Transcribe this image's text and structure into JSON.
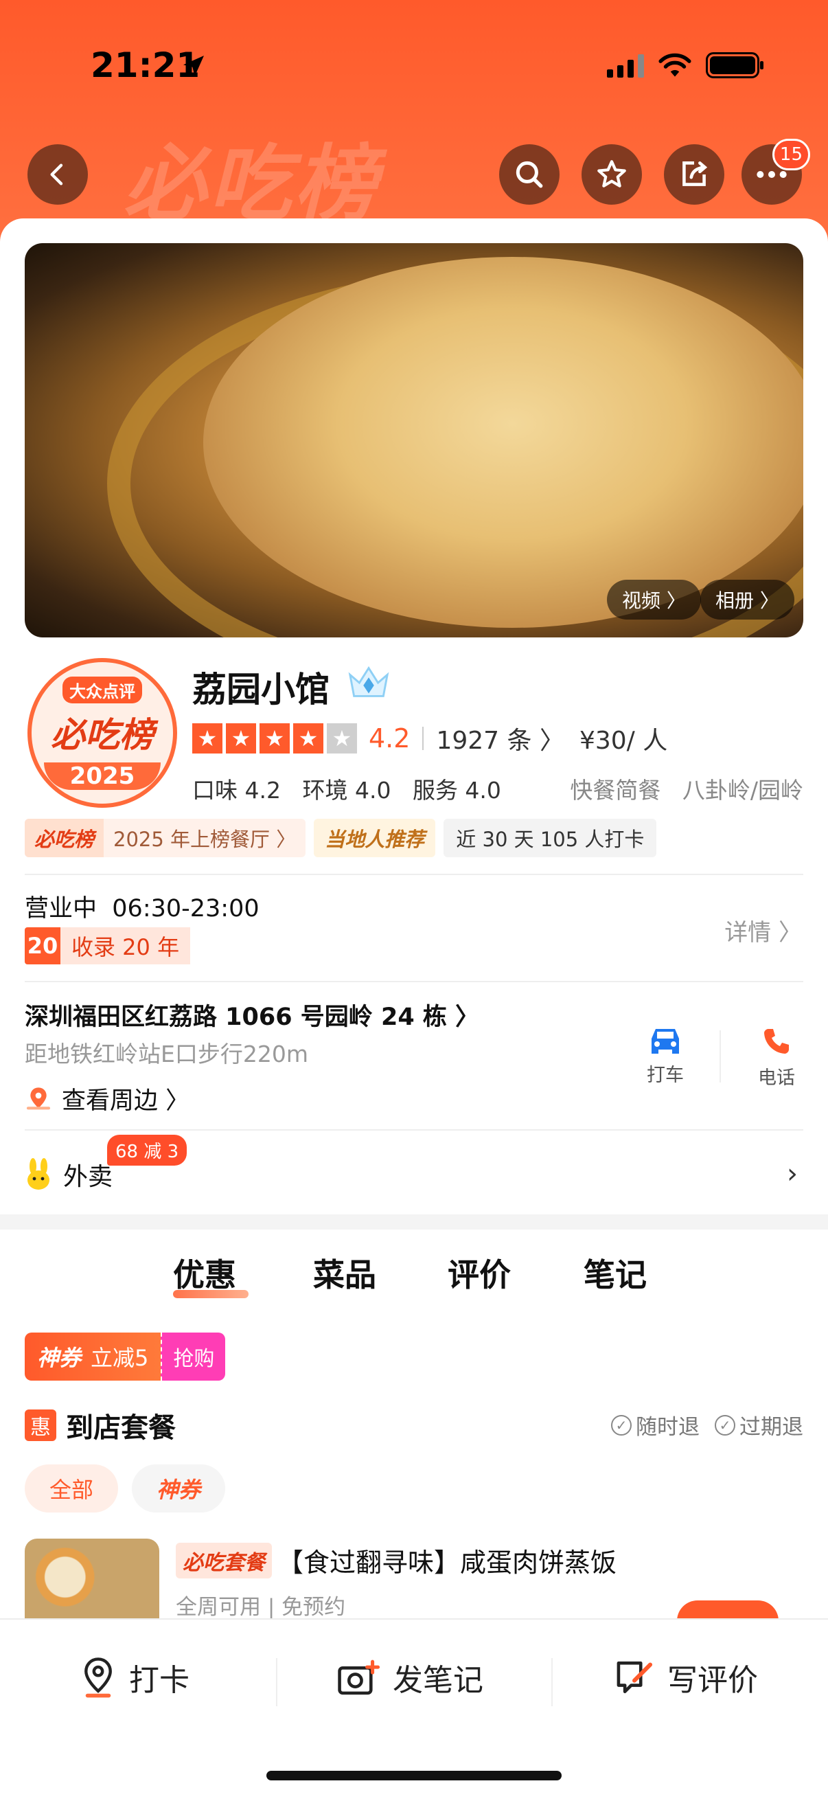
{
  "status": {
    "time": "21:21"
  },
  "nav": {
    "badge_count": "15"
  },
  "gallery": {
    "video_label": "视频 〉",
    "album_label": "相册 〉"
  },
  "medal": {
    "brand": "大众点评",
    "title": "必吃榜",
    "year": "2025"
  },
  "shop": {
    "name": "荔园小馆",
    "score": "4.2",
    "stars": 4,
    "review_count": "1927 条 〉",
    "price": "¥30/ 人",
    "taste": "口味 4.2",
    "environment": "环境 4.0",
    "service": "服务 4.0",
    "category": "快餐简餐",
    "area": "八卦岭/园岭"
  },
  "tags": {
    "list_logo": "必吃榜",
    "list_text": "2025 年上榜餐厅 〉",
    "local": "当地人推荐",
    "checkin": "近 30 天 105 人打卡"
  },
  "hours": {
    "status": "营业中",
    "time": "06:30-23:00",
    "detail": "详情 〉",
    "since_num": "20",
    "since_text": "收录 20 年"
  },
  "location": {
    "address": "深圳福田区红荔路 1066 号园岭 24 栋 〉",
    "metro": "距地铁红岭站E口步行220m",
    "nearby": "查看周边 〉",
    "taxi_label": "打车",
    "phone_label": "电话"
  },
  "takeout": {
    "label": "外卖",
    "badge": "68 减 3"
  },
  "tabs": [
    "优惠",
    "菜品",
    "评价",
    "笔记"
  ],
  "coupon": {
    "tag": "神券",
    "text": "立减5",
    "action": "抢购"
  },
  "package": {
    "icon_text": "惠",
    "title": "到店套餐",
    "policy_1": "随时退",
    "policy_2": "过期退",
    "filter_all": "全部",
    "filter_coupon": "神券"
  },
  "deal": {
    "tag": "必吃套餐",
    "name": "【食过翻寻味】咸蛋肉饼蒸饭",
    "sub": "全周可用 | 免预约"
  },
  "bottom_bar": {
    "checkin": "打卡",
    "note": "发笔记",
    "review": "写评价"
  },
  "colors": {
    "accent": "#ff5a2b",
    "coupon_pink": "#ff3db5"
  }
}
